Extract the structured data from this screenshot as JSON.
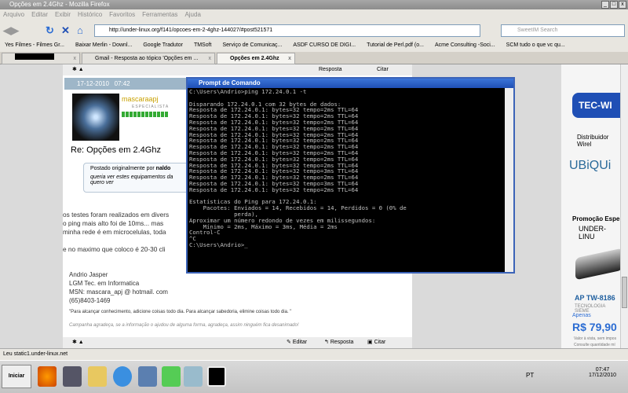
{
  "window": {
    "title": "Opções em 2.4Ghz - Mozilla Firefox"
  },
  "menu": [
    "Arquivo",
    "Editar",
    "Exibir",
    "Histórico",
    "Favoritos",
    "Ferramentas",
    "Ajuda"
  ],
  "url": "http://under-linux.org/f141/opcoes-em-2-4ghz-144027/#post521571",
  "search_placeholder": "SweetIM Search",
  "bookmarks": [
    "Yes Filmes - Filmes Gr...",
    "Baixar Merlin - Downl...",
    "Google Tradutor",
    "TMSoft",
    "Serviço de Comunicaç...",
    "ASDF CURSO DE DIGI...",
    "Tutorial de Perl.pdf (o...",
    "Acme Consulting -Soci...",
    "SCM tudo o que vc qu..."
  ],
  "tabs": [
    {
      "label": ""
    },
    {
      "label": "Gmail - Resposta ao tópico 'Opções em ..."
    },
    {
      "label": "Opções em 2.4Ghz"
    }
  ],
  "post": {
    "top_actions": [
      "Resposta",
      "Citar"
    ],
    "date": "17-12-2010",
    "time": "07:42",
    "username": "mascaraapj",
    "rank": "ESPECIALISTA",
    "title": "Re: Opções em 2.4Ghz",
    "quote_header": "Postado originalmente por",
    "quote_author": "naldo",
    "quote_text": "queria ver estes equipamentos da",
    "quote_text2": "quero ver",
    "body": [
      "os testes foram realizados em divers",
      "o ping mais alto foi de 10ms... mas",
      "minha rede é em microcelulas, toda",
      "e no maximo que coloco é 20-30 cli"
    ],
    "signature": [
      "Andrio Jasper",
      "LGM Tec. em Informatica",
      "MSN: mascara_apj @ hotmail. com",
      "(65)8403-1469"
    ],
    "quote_line": "\"Para alcançar conhecimento, adicione coisas todo dia. Para alcançar sabedoria, elimine coisas todo dia. \"",
    "campaign": "Campanha agradeça, se a informação o ajudou de alguma forma, agradeça, assim ninguém fica desanimado!",
    "actions": [
      "Editar",
      "Resposta",
      "Citar"
    ]
  },
  "console": {
    "title": "Prompt de Comando",
    "output": "C:\\Users\\Andrio>ping 172.24.0.1 -t\n\nDisparando 172.24.0.1 com 32 bytes de dados:\nResposta de 172.24.0.1: bytes=32 tempo=2ms TTL=64\nResposta de 172.24.0.1: bytes=32 tempo=2ms TTL=64\nResposta de 172.24.0.1: bytes=32 tempo=2ms TTL=64\nResposta de 172.24.0.1: bytes=32 tempo=2ms TTL=64\nResposta de 172.24.0.1: bytes=32 tempo=2ms TTL=64\nResposta de 172.24.0.1: bytes=32 tempo=2ms TTL=64\nResposta de 172.24.0.1: bytes=32 tempo=2ms TTL=64\nResposta de 172.24.0.1: bytes=32 tempo=2ms TTL=64\nResposta de 172.24.0.1: bytes=32 tempo=2ms TTL=64\nResposta de 172.24.0.1: bytes=32 tempo=2ms TTL=64\nResposta de 172.24.0.1: bytes=32 tempo=3ms TTL=64\nResposta de 172.24.0.1: bytes=32 tempo=2ms TTL=64\nResposta de 172.24.0.1: bytes=32 tempo=3ms TTL=64\nResposta de 172.24.0.1: bytes=32 tempo=2ms TTL=64\n\nEstatísticas do Ping para 172.24.0.1:\n    Pacotes: Enviados = 14, Recebidos = 14, Perdidos = 0 (0% de\n             perda),\nAproximar um número redondo de vezes em milissegundos:\n    Mínimo = 2ms, Máximo = 3ms, Média = 2ms\nControl-C\n^C\nC:\\Users\\Andrio>_"
  },
  "ad": {
    "brand": "TEC-WI",
    "line1": "Distribuidor Wirel",
    "ubiquiti": "UBiQUi",
    "promo": "Promoção Espe",
    "promo2": "UNDER-LINU",
    "model": "AP TW-8186",
    "tech": "TECNOLOGIA SIEME",
    "apenas": "Apenas",
    "price": "R$ 79,90",
    "note1": "Valor à vista, sem impos",
    "note2": "Consulte quantidade mí"
  },
  "status": "Leu static1.under-linux.net",
  "taskbar": {
    "start": "Iniciar",
    "lang": "PT",
    "time": "07:47",
    "date": "17/12/2010"
  }
}
